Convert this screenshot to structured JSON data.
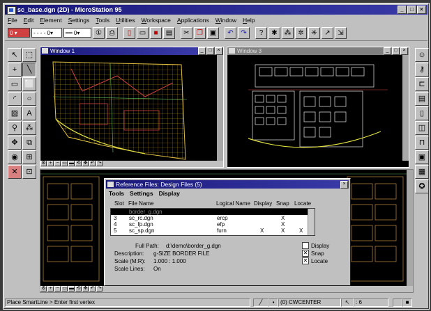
{
  "app": {
    "title": "sc_base.dgn (2D) - MicroStation 95",
    "window_buttons": [
      "_",
      "□",
      "×"
    ]
  },
  "menu": [
    "File",
    "Edit",
    "Element",
    "Settings",
    "Tools",
    "Utilities",
    "Workspace",
    "Applications",
    "Window",
    "Help"
  ],
  "toolbar": {
    "color_value": "0",
    "linestyle_value": "0",
    "weight_value": "0"
  },
  "views": {
    "window1": {
      "title": "Window 1"
    },
    "window3": {
      "title": "Window 3"
    }
  },
  "dialog": {
    "title": "Reference Files: Design Files (5)",
    "menus": [
      "Tools",
      "Settings",
      "Display"
    ],
    "columns": [
      "Slot",
      "File Name",
      "Logical Name",
      "Display",
      "Snap",
      "Locate"
    ],
    "rows": [
      {
        "slot": "",
        "file": "border_g.dgn",
        "logical": "",
        "display": "",
        "snap": "",
        "locate": "",
        "selected": true
      },
      {
        "slot": "3",
        "file": "sc_rc.dgn",
        "logical": "ercp",
        "display": "",
        "snap": "X",
        "locate": "",
        "selected": false
      },
      {
        "slot": "4",
        "file": "sc_fp.dgn",
        "logical": "efp",
        "display": "",
        "snap": "X",
        "locate": "",
        "selected": false
      },
      {
        "slot": "5",
        "file": "sc_sp.dgn",
        "logical": "furn",
        "display": "X",
        "snap": "X",
        "locate": "X",
        "selected": false
      }
    ],
    "full_path_label": "Full Path:",
    "full_path": "d:\\demo\\border_g.dgn",
    "description_label": "Description:",
    "description": "g-SIZE BORDER FILE",
    "scale_label": "Scale (M:R):",
    "scale": "1.000 : 1.000",
    "scale_lines_label": "Scale Lines:",
    "scale_lines": "On",
    "checkboxes": [
      {
        "label": "Display",
        "checked": false
      },
      {
        "label": "Snap",
        "checked": true
      },
      {
        "label": "Locate",
        "checked": true
      }
    ]
  },
  "status": {
    "prompt": "Place SmartLine > Enter first vertex",
    "level": "(0) CWCENTER",
    "snap_count": "6"
  }
}
